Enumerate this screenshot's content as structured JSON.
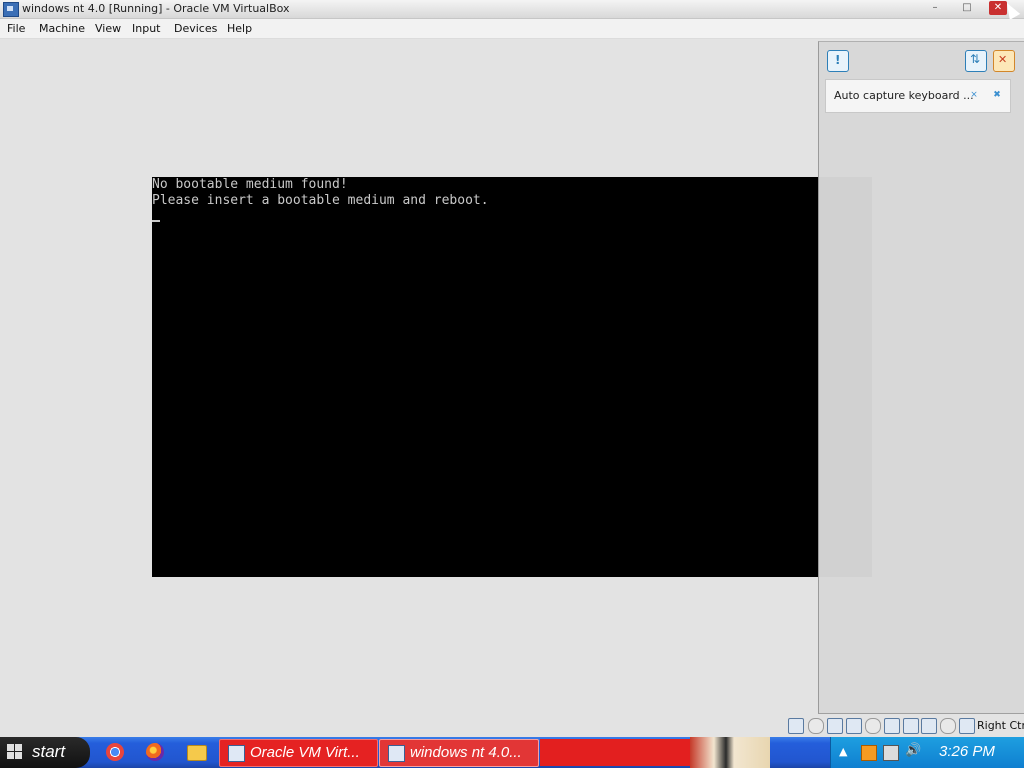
{
  "window": {
    "title": "windows nt 4.0 [Running] - Oracle VM VirtualBox",
    "controls": {
      "minimize": "–",
      "maximize": "□",
      "close": "✕"
    }
  },
  "menu": [
    "File",
    "Machine",
    "View",
    "Input",
    "Devices",
    "Help"
  ],
  "console": {
    "lines": [
      "No bootable medium found!",
      "Please insert a bootable medium and reboot."
    ],
    "text_color": "#c9c9c9",
    "background": "#000000"
  },
  "notification_panel": {
    "notification_text": "Auto capture keyboard ..."
  },
  "statusbar": {
    "host_key": "Right Ctrl",
    "icons": [
      "hard-disk-icon",
      "optical-drive-icon",
      "audio-icon",
      "network-icon",
      "usb-icon",
      "shared-folders-icon",
      "display-icon",
      "video-capture-icon",
      "mouse-integration-icon",
      "keyboard-capture-icon"
    ]
  },
  "taskbar": {
    "start_label": "start",
    "buttons": [
      {
        "label": "Oracle VM Virt..."
      },
      {
        "label": "windows nt 4.0..."
      }
    ],
    "clock": "3:26 PM",
    "colors": {
      "taskbar": "#245edb",
      "tray": "#0f7fd0",
      "active_button": "#e23636"
    }
  }
}
